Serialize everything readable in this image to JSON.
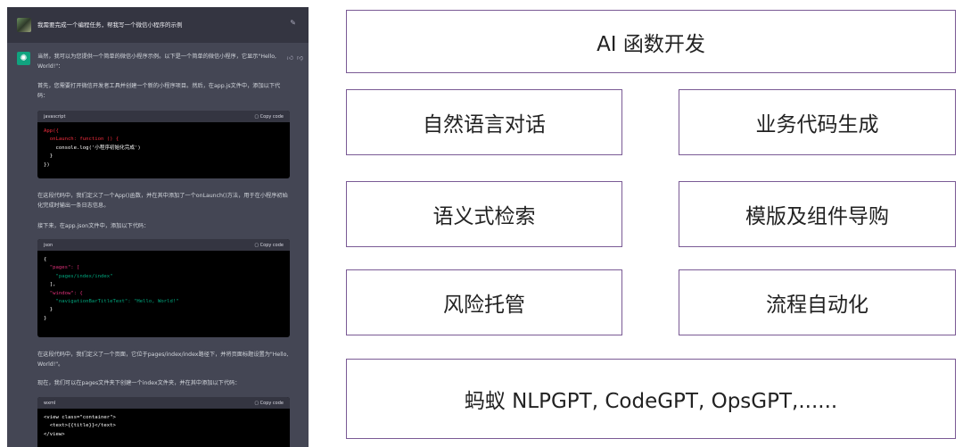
{
  "chat": {
    "user_message": "我需要完成一个编程任务，帮我写一个微信小程序的示例",
    "paragraphs": [
      "当然，我可以为您提供一个简单的微信小程序示例。以下是一个简单的微信小程序，它显示\"Hello, World!\"：",
      "首先，您需要打开微信开发者工具并创建一个新的小程序项目。然后，在app.js文件中，添加以下代码：",
      "在这段代码中，我们定义了一个App()函数，并在其中添加了一个onLaunch()方法，用于在小程序初始化完成时输出一条日志信息。",
      "接下来，在app.json文件中，添加以下代码：",
      "在这段代码中，我们定义了一个页面，它位于pages/index/index路径下，并将页面标题设置为\"Hello, World!\"。",
      "现在，我们可以在pages文件夹下创建一个index文件夹，并在其中添加以下代码："
    ],
    "copy_label": "Copy code",
    "code_blocks": [
      {
        "lang": "javascript",
        "lines": [
          "App({",
          "  onLaunch: function () {",
          "    console.log('小程序初始化完成')",
          "  }",
          "})"
        ]
      },
      {
        "lang": "json",
        "lines": [
          "{",
          "  \"pages\": [",
          "    \"pages/index/index\"",
          "  ],",
          "  \"window\": {",
          "    \"navigationBarTitleText\": \"Hello, World!\"",
          "  }",
          "}"
        ]
      },
      {
        "lang": "wxml",
        "lines": [
          "<view class=\"container\">",
          "  <text>{{title}}</text>",
          "</view>"
        ]
      }
    ]
  },
  "diagram": {
    "top": "AI 函数开发",
    "left": [
      "自然语言对话",
      "语义式检索",
      "风险托管"
    ],
    "right": [
      "业务代码生成",
      "模版及组件导购",
      "流程自动化"
    ],
    "bottom": "蚂蚁 NLPGPT, CodeGPT, OpsGPT,......",
    "border_color": "#7a5a95"
  }
}
